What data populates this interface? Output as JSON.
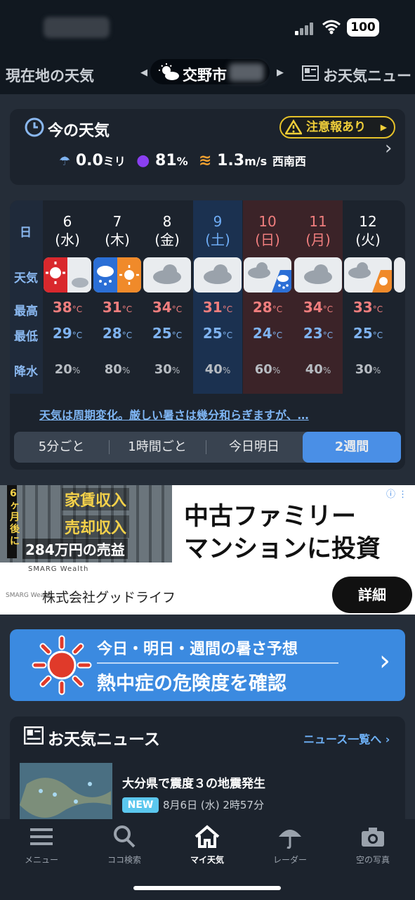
{
  "status": {
    "battery": "100"
  },
  "tabs": {
    "left": "現在地の天気",
    "city": "交野市",
    "right": "お天気ニュー"
  },
  "now": {
    "title": "今の天気",
    "warning": "注意報あり",
    "rain_value": "0.0",
    "rain_unit": "ミリ",
    "humidity_value": "81",
    "humidity_unit": "%",
    "wind_value": "1.3",
    "wind_unit": "m/s",
    "wind_dir": "西南西"
  },
  "forecast": {
    "labels": {
      "day": "日",
      "weather": "天気",
      "high": "最高",
      "low": "最低",
      "rain": "降水"
    },
    "days": [
      {
        "date": "6",
        "dow": "(水)",
        "hi": "38",
        "lo": "29",
        "rain": "20"
      },
      {
        "date": "7",
        "dow": "(木)",
        "hi": "31",
        "lo": "28",
        "rain": "80"
      },
      {
        "date": "8",
        "dow": "(金)",
        "hi": "34",
        "lo": "25",
        "rain": "30"
      },
      {
        "date": "9",
        "dow": "(土)",
        "hi": "31",
        "lo": "25",
        "rain": "40"
      },
      {
        "date": "10",
        "dow": "(日)",
        "hi": "28",
        "lo": "24",
        "rain": "60"
      },
      {
        "date": "11",
        "dow": "(月)",
        "hi": "34",
        "lo": "23",
        "rain": "40"
      },
      {
        "date": "12",
        "dow": "(火)",
        "hi": "33",
        "lo": "25",
        "rain": "30"
      }
    ],
    "temp_unit": "°C",
    "rain_unit": "%",
    "summary": "天気は周期変化。厳しい暑さは幾分和らぎますが、…",
    "segments": [
      "5分ごと",
      "1時間ごと",
      "今日明日",
      "2週間"
    ]
  },
  "ad": {
    "headline1": "中古ファミリー",
    "headline2": "マンションに投資",
    "company": "株式会社グッドライフ",
    "button": "詳細",
    "img_text1": "家賃収入",
    "img_text2": "売却収入",
    "img_text3": "6ヶ月後に",
    "img_text4": "284万円の売益",
    "brand": "SMARG Wealth"
  },
  "heat": {
    "line1": "今日・明日・週間の暑さ予想",
    "line2": "熱中症の危険度を確認"
  },
  "news": {
    "title": "お天気ニュース",
    "link": "ニュース一覧へ",
    "headline": "大分県で震度３の地震発生",
    "badge": "NEW",
    "date": "8月6日 (水) 2時57分"
  },
  "nav": {
    "menu": "メニュー",
    "search": "ココ検索",
    "my": "マイ天気",
    "radar": "レーダー",
    "photo": "空の写真"
  },
  "colors": {
    "accent": "#4a8fe6",
    "hi": "#f07e7e",
    "lo": "#7fb3f0",
    "warn": "#f1cf3a"
  }
}
